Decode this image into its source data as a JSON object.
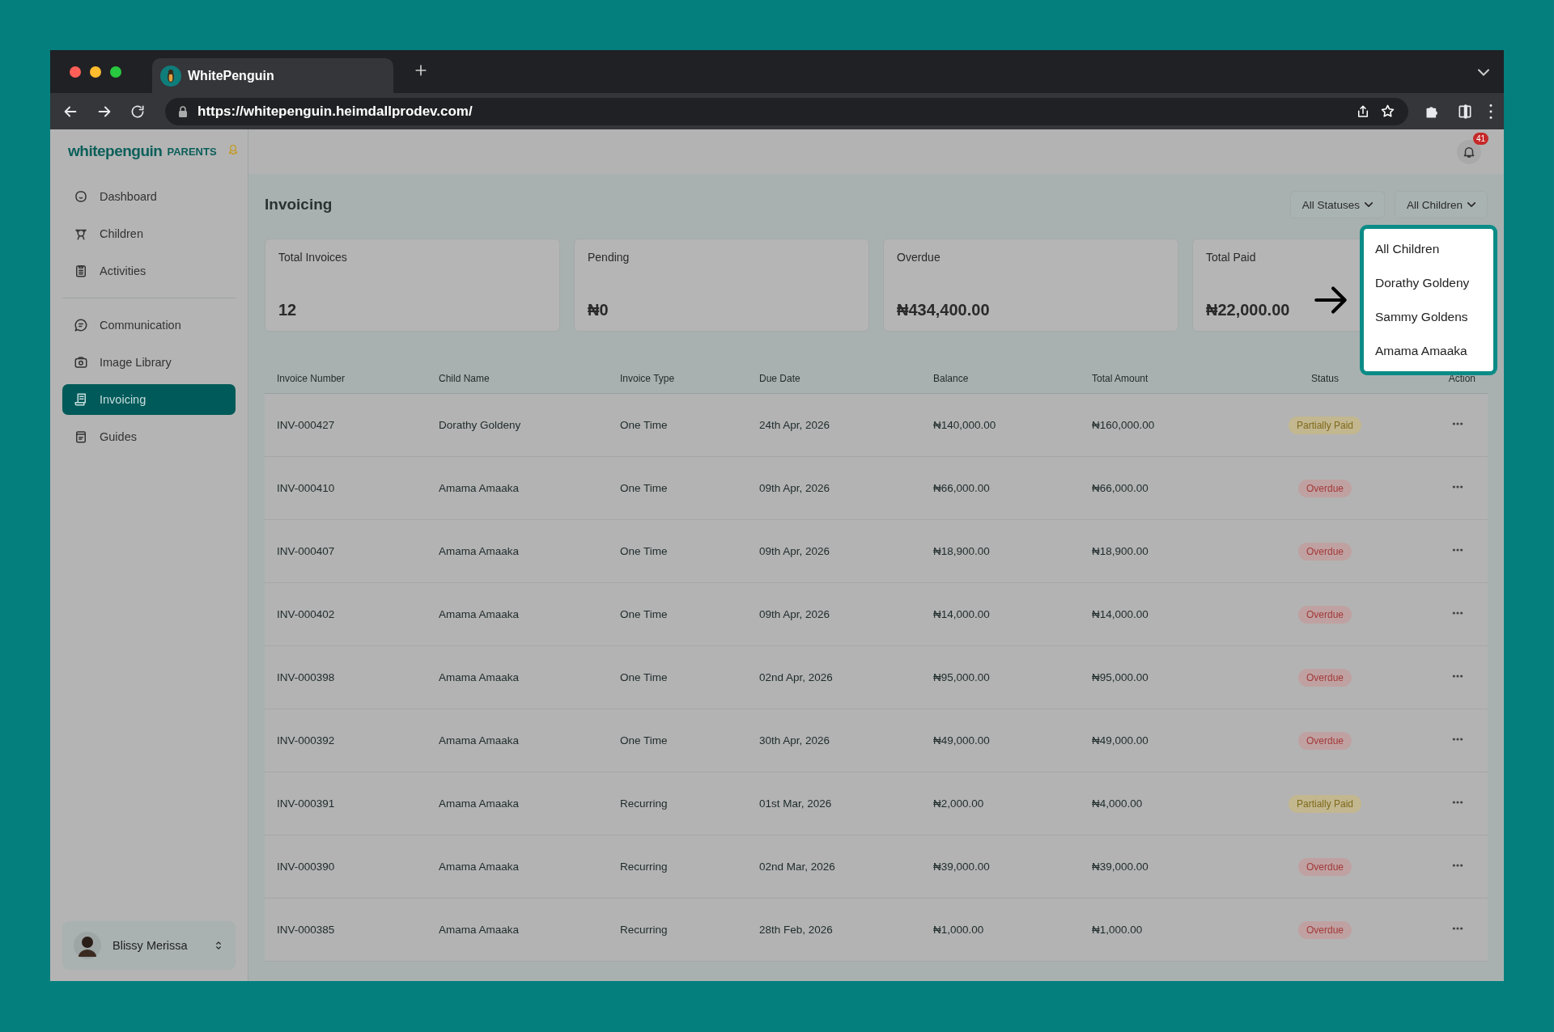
{
  "browser": {
    "tab_title": "WhitePenguin",
    "url": "https://whitepenguin.heimdallprodev.com/"
  },
  "sidebar": {
    "logo": {
      "brand": "whitepenguin",
      "suffix": "PARENTS"
    },
    "groups": [
      [
        {
          "label": "Dashboard",
          "selected": false
        },
        {
          "label": "Children",
          "selected": false
        },
        {
          "label": "Activities",
          "selected": false
        }
      ],
      [
        {
          "label": "Communication",
          "selected": false
        },
        {
          "label": "Image Library",
          "selected": false
        },
        {
          "label": "Invoicing",
          "selected": true
        },
        {
          "label": "Guides",
          "selected": false
        }
      ]
    ],
    "user": {
      "name": "Blissy Merissa"
    }
  },
  "header": {
    "notification_count": "41"
  },
  "page": {
    "title": "Invoicing",
    "filters": [
      "All Statuses",
      "All Children"
    ]
  },
  "cards": [
    {
      "label": "Total Invoices",
      "value": "12"
    },
    {
      "label": "Pending",
      "value": "₦0"
    },
    {
      "label": "Overdue",
      "value": "₦434,400.00"
    },
    {
      "label": "Total Paid",
      "value": "₦22,000.00"
    }
  ],
  "table": {
    "columns": [
      "Invoice Number",
      "Child Name",
      "Invoice Type",
      "Due Date",
      "Balance",
      "Total Amount",
      "Status",
      "Action"
    ],
    "rows": [
      {
        "invoice_number": "INV-000427",
        "child_name": "Dorathy Goldeny",
        "invoice_type": "One Time",
        "due_date": "24th Apr, 2026",
        "balance": "₦140,000.00",
        "total_amount": "₦160,000.00",
        "status": {
          "label": "Partially Paid",
          "kind": "partial"
        }
      },
      {
        "invoice_number": "INV-000410",
        "child_name": "Amama Amaaka",
        "invoice_type": "One Time",
        "due_date": "09th Apr, 2026",
        "balance": "₦66,000.00",
        "total_amount": "₦66,000.00",
        "status": {
          "label": "Overdue",
          "kind": "overdue"
        }
      },
      {
        "invoice_number": "INV-000407",
        "child_name": "Amama Amaaka",
        "invoice_type": "One Time",
        "due_date": "09th Apr, 2026",
        "balance": "₦18,900.00",
        "total_amount": "₦18,900.00",
        "status": {
          "label": "Overdue",
          "kind": "overdue"
        }
      },
      {
        "invoice_number": "INV-000402",
        "child_name": "Amama Amaaka",
        "invoice_type": "One Time",
        "due_date": "09th Apr, 2026",
        "balance": "₦14,000.00",
        "total_amount": "₦14,000.00",
        "status": {
          "label": "Overdue",
          "kind": "overdue"
        }
      },
      {
        "invoice_number": "INV-000398",
        "child_name": "Amama Amaaka",
        "invoice_type": "One Time",
        "due_date": "02nd Apr, 2026",
        "balance": "₦95,000.00",
        "total_amount": "₦95,000.00",
        "status": {
          "label": "Overdue",
          "kind": "overdue"
        }
      },
      {
        "invoice_number": "INV-000392",
        "child_name": "Amama Amaaka",
        "invoice_type": "One Time",
        "due_date": "30th Apr, 2026",
        "balance": "₦49,000.00",
        "total_amount": "₦49,000.00",
        "status": {
          "label": "Overdue",
          "kind": "overdue"
        }
      },
      {
        "invoice_number": "INV-000391",
        "child_name": "Amama Amaaka",
        "invoice_type": "Recurring",
        "due_date": "01st Mar, 2026",
        "balance": "₦2,000.00",
        "total_amount": "₦4,000.00",
        "status": {
          "label": "Partially Paid",
          "kind": "partial"
        }
      },
      {
        "invoice_number": "INV-000390",
        "child_name": "Amama Amaaka",
        "invoice_type": "Recurring",
        "due_date": "02nd Mar, 2026",
        "balance": "₦39,000.00",
        "total_amount": "₦39,000.00",
        "status": {
          "label": "Overdue",
          "kind": "overdue"
        }
      },
      {
        "invoice_number": "INV-000385",
        "child_name": "Amama Amaaka",
        "invoice_type": "Recurring",
        "due_date": "28th Feb, 2026",
        "balance": "₦1,000.00",
        "total_amount": "₦1,000.00",
        "status": {
          "label": "Overdue",
          "kind": "overdue"
        }
      }
    ]
  },
  "dropdown": {
    "options": [
      "All Children",
      "Dorathy Goldeny",
      "Sammy Goldens",
      "Amama Amaaka"
    ]
  }
}
